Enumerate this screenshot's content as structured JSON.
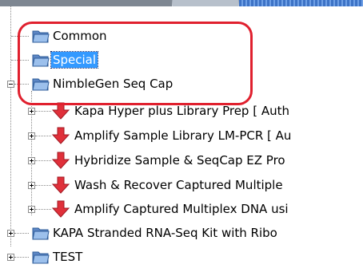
{
  "tree": {
    "folders": [
      {
        "label": "Common",
        "selected": false,
        "expander": "none"
      },
      {
        "label": "Special",
        "selected": true,
        "expander": "none"
      },
      {
        "label": "NimbleGen Seq Cap",
        "selected": false,
        "expander": "minus"
      },
      {
        "label": "KAPA Stranded RNA-Seq Kit with Ribo",
        "selected": false,
        "expander": "plus"
      },
      {
        "label": "TEST",
        "selected": false,
        "expander": "plus"
      }
    ],
    "steps": [
      {
        "label": "Kapa Hyper plus Library Prep [ Auth"
      },
      {
        "label": "Amplify Sample Library LM-PCR [ Au"
      },
      {
        "label": "Hybridize Sample & SeqCap EZ Pro"
      },
      {
        "label": "Wash & Recover Captured Multiple"
      },
      {
        "label": "Amplify Captured Multiplex DNA usi"
      }
    ]
  },
  "icons": {
    "folder": "folder-icon",
    "step": "red-down-arrow-icon"
  },
  "colors": {
    "selection": "#3399ff",
    "highlight_outline": "#e0202e",
    "folder": "#7fa7da",
    "arrow": "#e0303a"
  }
}
